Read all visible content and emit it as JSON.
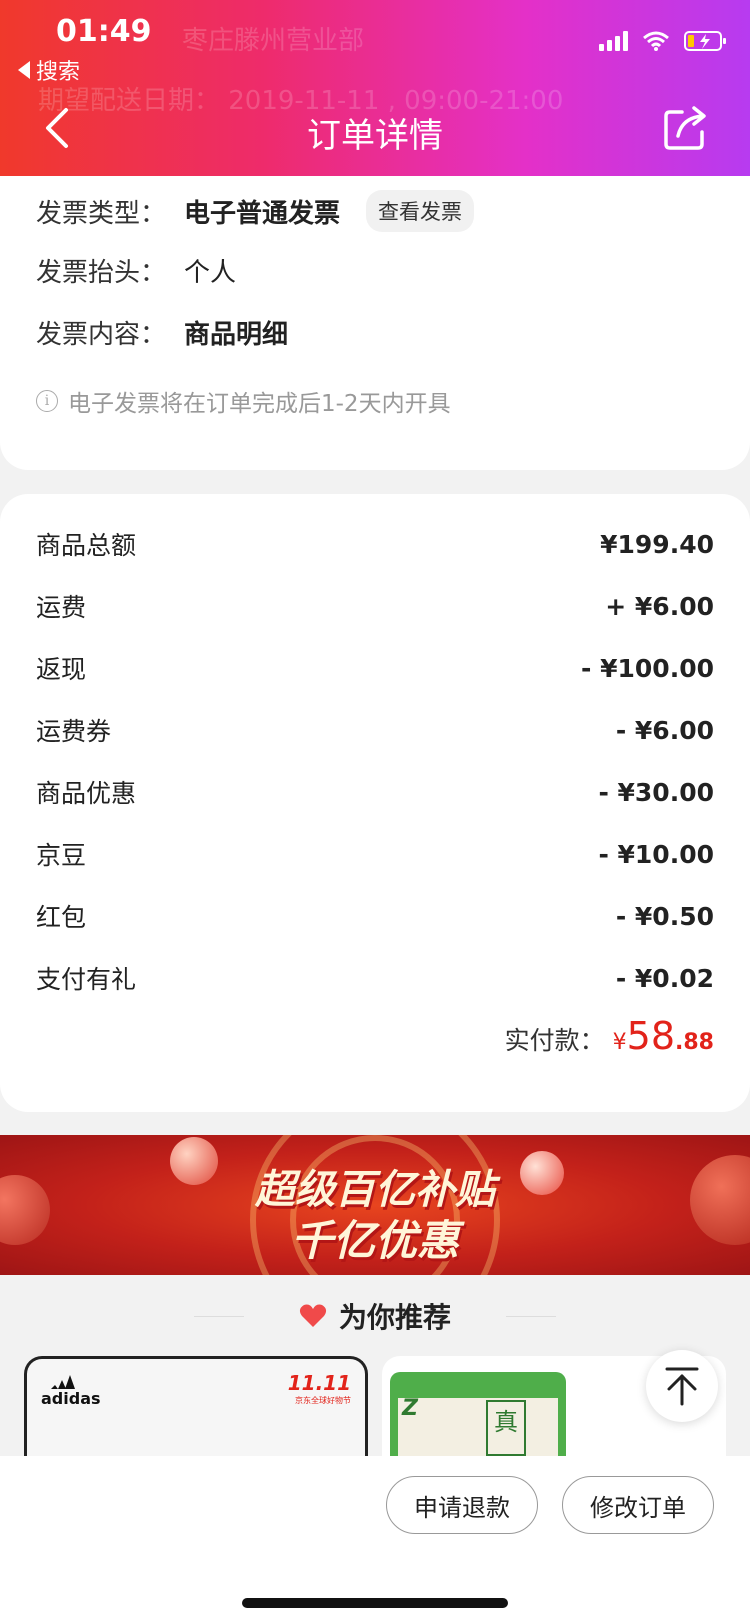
{
  "status_bar": {
    "time": "01:49",
    "back_app_label": "搜索"
  },
  "header": {
    "title": "订单详情",
    "ghost_line1": "枣庄滕州营业部",
    "ghost_line2": "期望配送日期：  2019-11-11 , 09:00-21:00"
  },
  "invoice": {
    "type_label": "发票类型：",
    "type_value": "电子普通发票",
    "view_button": "查看发票",
    "title_label": "发票抬头：",
    "title_value": "个人",
    "content_label": "发票内容：",
    "content_value": "商品明细",
    "note": "电子发票将在订单完成后1-2天内开具"
  },
  "amounts": [
    {
      "label": "商品总额",
      "value": "¥199.40"
    },
    {
      "label": "运费",
      "value": "+ ¥6.00"
    },
    {
      "label": "返现",
      "value": "- ¥100.00"
    },
    {
      "label": "运费券",
      "value": "- ¥6.00"
    },
    {
      "label": "商品优惠",
      "value": "- ¥30.00"
    },
    {
      "label": "京豆",
      "value": "- ¥10.00"
    },
    {
      "label": "红包",
      "value": "- ¥0.50"
    },
    {
      "label": "支付有礼",
      "value": "- ¥0.02"
    }
  ],
  "paid": {
    "label": "实付款：",
    "currency": "¥",
    "integer": "58",
    "decimal": ".88"
  },
  "banner": {
    "line1": "超级百亿补贴",
    "line2": "千亿优惠"
  },
  "recommend": {
    "title": "为你推荐"
  },
  "products": [
    {
      "brand": "adidas",
      "badge": "11.11",
      "badge_sub": "京东全球好物节"
    },
    {
      "pack_text": "真"
    }
  ],
  "actions": {
    "refund": "申请退款",
    "modify": "修改订单"
  },
  "colors": {
    "accent": "#e2231a",
    "header_start": "#f0392b",
    "header_end": "#b73bf0"
  }
}
